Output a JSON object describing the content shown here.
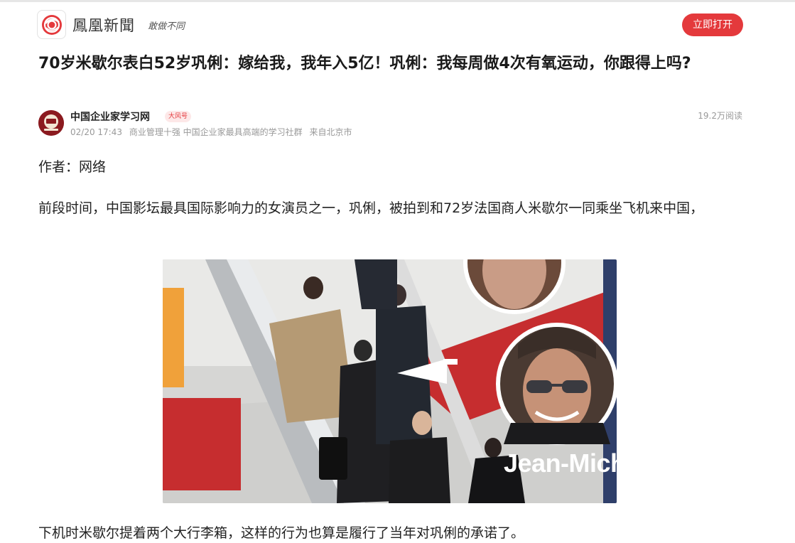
{
  "header": {
    "brand_name": "鳳凰新聞",
    "slogan": "敢做不同",
    "open_button_label": "立即打开"
  },
  "article": {
    "title": "70岁米歇尔表白52岁巩俐：嫁给我，我年入5亿！巩俐：我每周做4次有氧运动，你跟得上吗?",
    "author": {
      "name": "中国企业家学习网",
      "badge": "大风号",
      "date": "02/20 17:43",
      "tagline": "商业管理十强 中国企业家最具高端的学习社群",
      "location": "来自北京市"
    },
    "read_count": "19.2万阅读",
    "paragraphs": {
      "author_line": "作者：网络",
      "intro": "前段时间，中国影坛最具国际影响力的女演员之一，巩俐，被拍到和72岁法国商人米歇尔一同乘坐飞机来中国，",
      "after_photo": "下机时米歇尔提着两个大行李箱，这样的行为也算是履行了当年对巩俐的承诺了。"
    },
    "photo": {
      "overlay_label": "Jean-Mich"
    }
  },
  "colors": {
    "accent": "#e4393c",
    "meta_text": "#999999",
    "body_text": "#222222"
  }
}
